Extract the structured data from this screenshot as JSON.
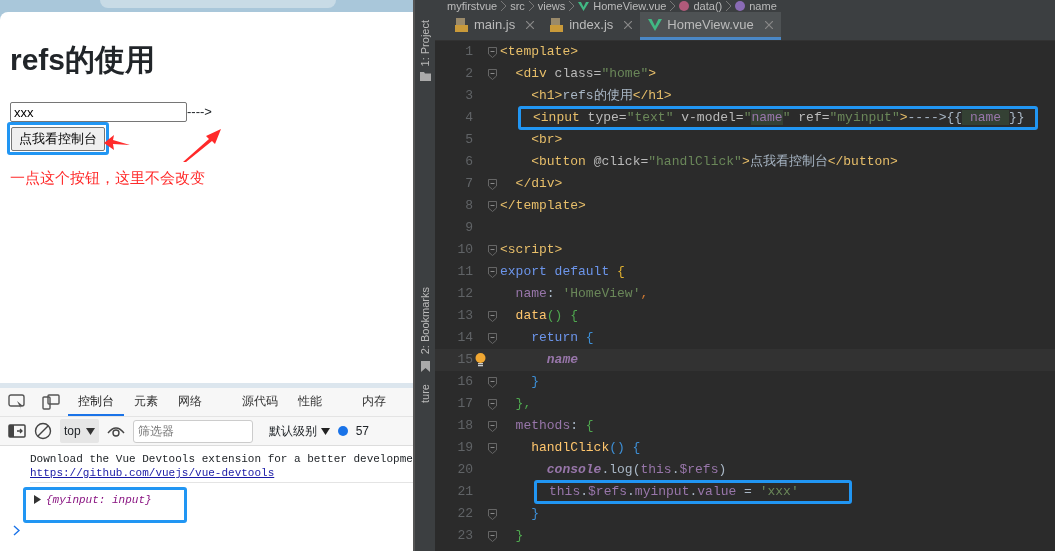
{
  "browser": {
    "heading": "refs的使用",
    "input_value": "xxx",
    "arrow_text": "---->",
    "button": "点我看控制台",
    "annotation": "一点这个按钮，这里不会改变"
  },
  "devtools": {
    "tabs": [
      {
        "label": "控制台",
        "selected": true
      },
      {
        "label": "元素",
        "selected": false
      },
      {
        "label": "网络",
        "selected": false
      },
      {
        "label": "源代码",
        "selected": false
      },
      {
        "label": "性能",
        "selected": false
      },
      {
        "label": "内存",
        "selected": false
      }
    ],
    "context": "top",
    "filter_placeholder": "筛选器",
    "log_level": "默认级别",
    "message_count": "57",
    "console": [
      {
        "kind": "message",
        "text": "Download the Vue Devtools extension for a better developme",
        "link": "https://github.com/vuejs/vue-devtools"
      },
      {
        "kind": "object",
        "text": "{myinput: input}"
      }
    ]
  },
  "ide": {
    "breadcrumb": [
      {
        "label": "myfirstvue",
        "kind": "folder"
      },
      {
        "label": "src",
        "kind": "folder"
      },
      {
        "label": "views",
        "kind": "folder"
      },
      {
        "label": "HomeView.vue",
        "kind": "vue"
      },
      {
        "label": "data()",
        "kind": "method"
      },
      {
        "label": "name",
        "kind": "property"
      }
    ],
    "side_tools": [
      {
        "label": "1: Project",
        "kind": "folder"
      },
      {
        "label": "2: Bookmarks",
        "kind": "bookmark"
      },
      {
        "label": "ture",
        "kind": "none"
      }
    ],
    "tabs": [
      {
        "label": "main.js",
        "kind": "js",
        "selected": false
      },
      {
        "label": "index.js",
        "kind": "js",
        "selected": false
      },
      {
        "label": "HomeView.vue",
        "kind": "vue",
        "selected": true
      }
    ],
    "lines": [
      {
        "number": "1",
        "fold": true,
        "boxed": false,
        "current": false,
        "tokens": [
          {
            "text": "<template>",
            "kind": "tag"
          }
        ]
      },
      {
        "number": "2",
        "fold": true,
        "boxed": false,
        "current": false,
        "tokens": [
          {
            "text": "  <div",
            "kind": "tag"
          },
          {
            "text": " class=",
            "kind": "attr"
          },
          {
            "text": "\"home\"",
            "kind": "str"
          },
          {
            "text": ">",
            "kind": "tag"
          }
        ]
      },
      {
        "number": "3",
        "fold": false,
        "boxed": false,
        "current": false,
        "tokens": [
          {
            "text": "    <h1>",
            "kind": "tag"
          },
          {
            "text": "refs的使用",
            "kind": "text"
          },
          {
            "text": "</h1>",
            "kind": "tag"
          }
        ]
      },
      {
        "number": "4",
        "fold": false,
        "boxed": true,
        "current": false,
        "tokens": [
          {
            "text": "<input",
            "kind": "tag"
          },
          {
            "text": " type=",
            "kind": "attr"
          },
          {
            "text": "\"text\"",
            "kind": "str"
          },
          {
            "text": " v-model=",
            "kind": "attr"
          },
          {
            "text": "\"",
            "kind": "str"
          },
          {
            "text": "name",
            "kind": "ref"
          },
          {
            "text": "\"",
            "kind": "str"
          },
          {
            "text": " ref=",
            "kind": "attr"
          },
          {
            "text": "\"myinput\"",
            "kind": "str"
          },
          {
            "text": ">",
            "kind": "tag"
          },
          {
            "text": "---->{{",
            "kind": "text"
          },
          {
            "text": " name ",
            "kind": "ref"
          },
          {
            "text": "}}",
            "kind": "text"
          }
        ]
      },
      {
        "number": "5",
        "fold": false,
        "boxed": false,
        "current": false,
        "tokens": [
          {
            "text": "    <br>",
            "kind": "tag"
          }
        ]
      },
      {
        "number": "6",
        "fold": false,
        "boxed": false,
        "current": false,
        "tokens": [
          {
            "text": "    <button",
            "kind": "tag"
          },
          {
            "text": " @click=",
            "kind": "attr"
          },
          {
            "text": "\"handlClick\"",
            "kind": "str"
          },
          {
            "text": ">",
            "kind": "tag"
          },
          {
            "text": "点我看控制台",
            "kind": "text"
          },
          {
            "text": "</button>",
            "kind": "tag"
          }
        ]
      },
      {
        "number": "7",
        "fold": true,
        "boxed": false,
        "current": false,
        "tokens": [
          {
            "text": "  </div>",
            "kind": "tag"
          }
        ]
      },
      {
        "number": "8",
        "fold": true,
        "boxed": false,
        "current": false,
        "tokens": [
          {
            "text": "</template>",
            "kind": "tag"
          }
        ]
      },
      {
        "number": "9",
        "fold": false,
        "boxed": false,
        "current": false
      },
      {
        "number": "10",
        "fold": true,
        "boxed": false,
        "current": false,
        "tokens": [
          {
            "text": "<script>",
            "kind": "tag"
          }
        ]
      },
      {
        "number": "11",
        "fold": true,
        "boxed": false,
        "current": false,
        "tokens": [
          {
            "text": "export default",
            "kind": "kw"
          },
          {
            "text": " {",
            "kind": "brace"
          }
        ]
      },
      {
        "number": "12",
        "fold": false,
        "boxed": false,
        "current": false,
        "tokens": [
          {
            "text": "  name",
            "kind": "prop"
          },
          {
            "text": ": ",
            "kind": "text"
          },
          {
            "text": "'HomeView'",
            "kind": "str"
          },
          {
            "text": ",",
            "kind": "punct"
          }
        ]
      },
      {
        "number": "13",
        "fold": true,
        "boxed": false,
        "current": false,
        "tokens": [
          {
            "text": "  data",
            "kind": "fn"
          },
          {
            "text": "() {",
            "kind": "brace2"
          }
        ]
      },
      {
        "number": "14",
        "fold": true,
        "boxed": false,
        "current": false,
        "tokens": [
          {
            "text": "    return",
            "kind": "kw"
          },
          {
            "text": " {",
            "kind": "brace3"
          }
        ]
      },
      {
        "number": "15",
        "fold": false,
        "boxed": false,
        "current": true,
        "tokens": [
          {
            "text": "      name",
            "kind": "italic"
          }
        ]
      },
      {
        "number": "16",
        "fold": true,
        "boxed": false,
        "current": false,
        "tokens": [
          {
            "text": "    }",
            "kind": "brace3"
          }
        ]
      },
      {
        "number": "17",
        "fold": true,
        "boxed": false,
        "current": false,
        "tokens": [
          {
            "text": "  },",
            "kind": "brace2"
          }
        ]
      },
      {
        "number": "18",
        "fold": true,
        "boxed": false,
        "current": false,
        "tokens": [
          {
            "text": "  methods",
            "kind": "prop"
          },
          {
            "text": ": ",
            "kind": "text"
          },
          {
            "text": "{",
            "kind": "brace2"
          }
        ]
      },
      {
        "number": "19",
        "fold": true,
        "boxed": false,
        "current": false,
        "tokens": [
          {
            "text": "    handlClick",
            "kind": "fn"
          },
          {
            "text": "() {",
            "kind": "brace3"
          }
        ]
      },
      {
        "number": "20",
        "fold": false,
        "boxed": false,
        "current": false,
        "tokens": [
          {
            "text": "      console",
            "kind": "italic"
          },
          {
            "text": ".log(",
            "kind": "text"
          },
          {
            "text": "this",
            "kind": "prop"
          },
          {
            "text": ".",
            "kind": "text"
          },
          {
            "text": "$refs",
            "kind": "prop"
          },
          {
            "text": ")",
            "kind": "text"
          }
        ]
      },
      {
        "number": "21",
        "fold": false,
        "boxed": true,
        "current": false,
        "tokens": [
          {
            "text": "this",
            "kind": "prop"
          },
          {
            "text": ".",
            "kind": "text"
          },
          {
            "text": "$refs",
            "kind": "prop"
          },
          {
            "text": ".",
            "kind": "text"
          },
          {
            "text": "myinput",
            "kind": "prop"
          },
          {
            "text": ".",
            "kind": "text"
          },
          {
            "text": "value",
            "kind": "prop"
          },
          {
            "text": " = ",
            "kind": "text"
          },
          {
            "text": "'xxx'",
            "kind": "str"
          }
        ]
      },
      {
        "number": "22",
        "fold": true,
        "boxed": false,
        "current": false,
        "tokens": [
          {
            "text": "    }",
            "kind": "brace3"
          }
        ]
      },
      {
        "number": "23",
        "fold": true,
        "boxed": false,
        "current": false,
        "tokens": [
          {
            "text": "  }",
            "kind": "brace2"
          }
        ]
      }
    ]
  }
}
